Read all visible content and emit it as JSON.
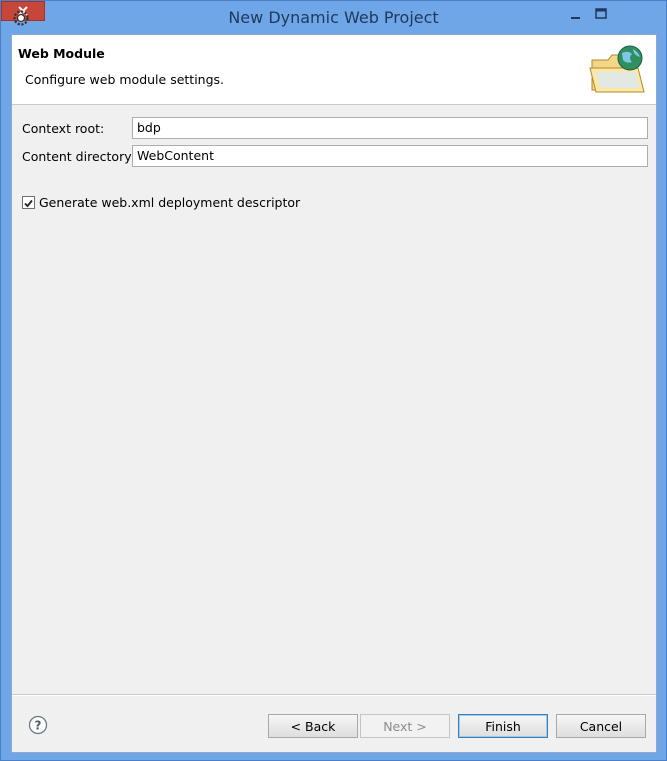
{
  "window": {
    "title": "New Dynamic Web Project"
  },
  "banner": {
    "title": "Web Module",
    "description": "Configure web module settings."
  },
  "form": {
    "context_root": {
      "label": "Context root:",
      "value": "bdp"
    },
    "content_directory": {
      "label": "Content directory:",
      "value": "WebContent"
    },
    "generate_descriptor": {
      "label": "Generate web.xml deployment descriptor",
      "checked": true
    }
  },
  "buttons": {
    "back": "< Back",
    "next": "Next >",
    "finish": "Finish",
    "cancel": "Cancel"
  },
  "icons": {
    "app": "eclipse-gear-icon",
    "banner": "folder-globe-icon",
    "help": "help-icon"
  },
  "colors": {
    "titlebar": "#6fa6e8",
    "close": "#c7463a",
    "finish_border": "#3c7fb1"
  }
}
